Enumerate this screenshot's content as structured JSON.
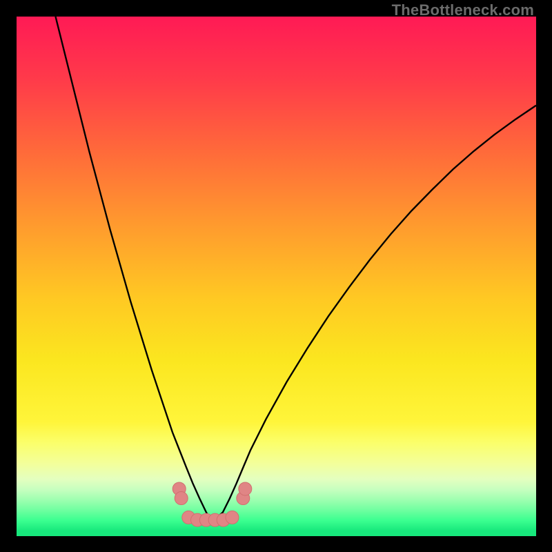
{
  "watermark": "TheBottleneck.com",
  "colors": {
    "frame": "#000000",
    "curve": "#000000",
    "marker_fill": "#e08585",
    "marker_stroke": "#d06f6f"
  },
  "chart_data": {
    "type": "line",
    "title": "",
    "xlabel": "",
    "ylabel": "",
    "xlim": [
      0,
      100
    ],
    "ylim": [
      0,
      100
    ],
    "series": [
      {
        "name": "left-curve",
        "x": [
          7.5,
          10,
          12,
          14,
          16,
          18,
          20,
          22,
          24,
          26,
          28,
          30,
          31.3,
          32.6,
          33.9,
          35.2,
          36.5,
          37.2,
          37.8
        ],
        "values": [
          100,
          90,
          82,
          74,
          66.5,
          59,
          52,
          45,
          38.5,
          32,
          26,
          20,
          16.7,
          13.4,
          10.2,
          7.3,
          4.6,
          3.4,
          3.1
        ]
      },
      {
        "name": "right-curve",
        "x": [
          37.8,
          38.4,
          39.7,
          41,
          42.3,
          43.6,
          45,
          48,
          52,
          56,
          60,
          64,
          68,
          72,
          76,
          80,
          84,
          88,
          92,
          96,
          100
        ],
        "values": [
          3.1,
          3.4,
          4.6,
          7.2,
          10.1,
          13.2,
          16.5,
          22.5,
          29.7,
          36.2,
          42.3,
          47.9,
          53.2,
          58.1,
          62.6,
          66.7,
          70.6,
          74.1,
          77.3,
          80.2,
          82.9
        ]
      }
    ],
    "markers": [
      {
        "x": 31.3,
        "y": 9.1
      },
      {
        "x": 31.7,
        "y": 7.3
      },
      {
        "x": 33.1,
        "y": 3.6
      },
      {
        "x": 34.8,
        "y": 3.1
      },
      {
        "x": 36.5,
        "y": 3.1
      },
      {
        "x": 38.2,
        "y": 3.1
      },
      {
        "x": 39.8,
        "y": 3.1
      },
      {
        "x": 41.5,
        "y": 3.6
      },
      {
        "x": 43.6,
        "y": 7.3
      },
      {
        "x": 44.0,
        "y": 9.1
      }
    ]
  }
}
